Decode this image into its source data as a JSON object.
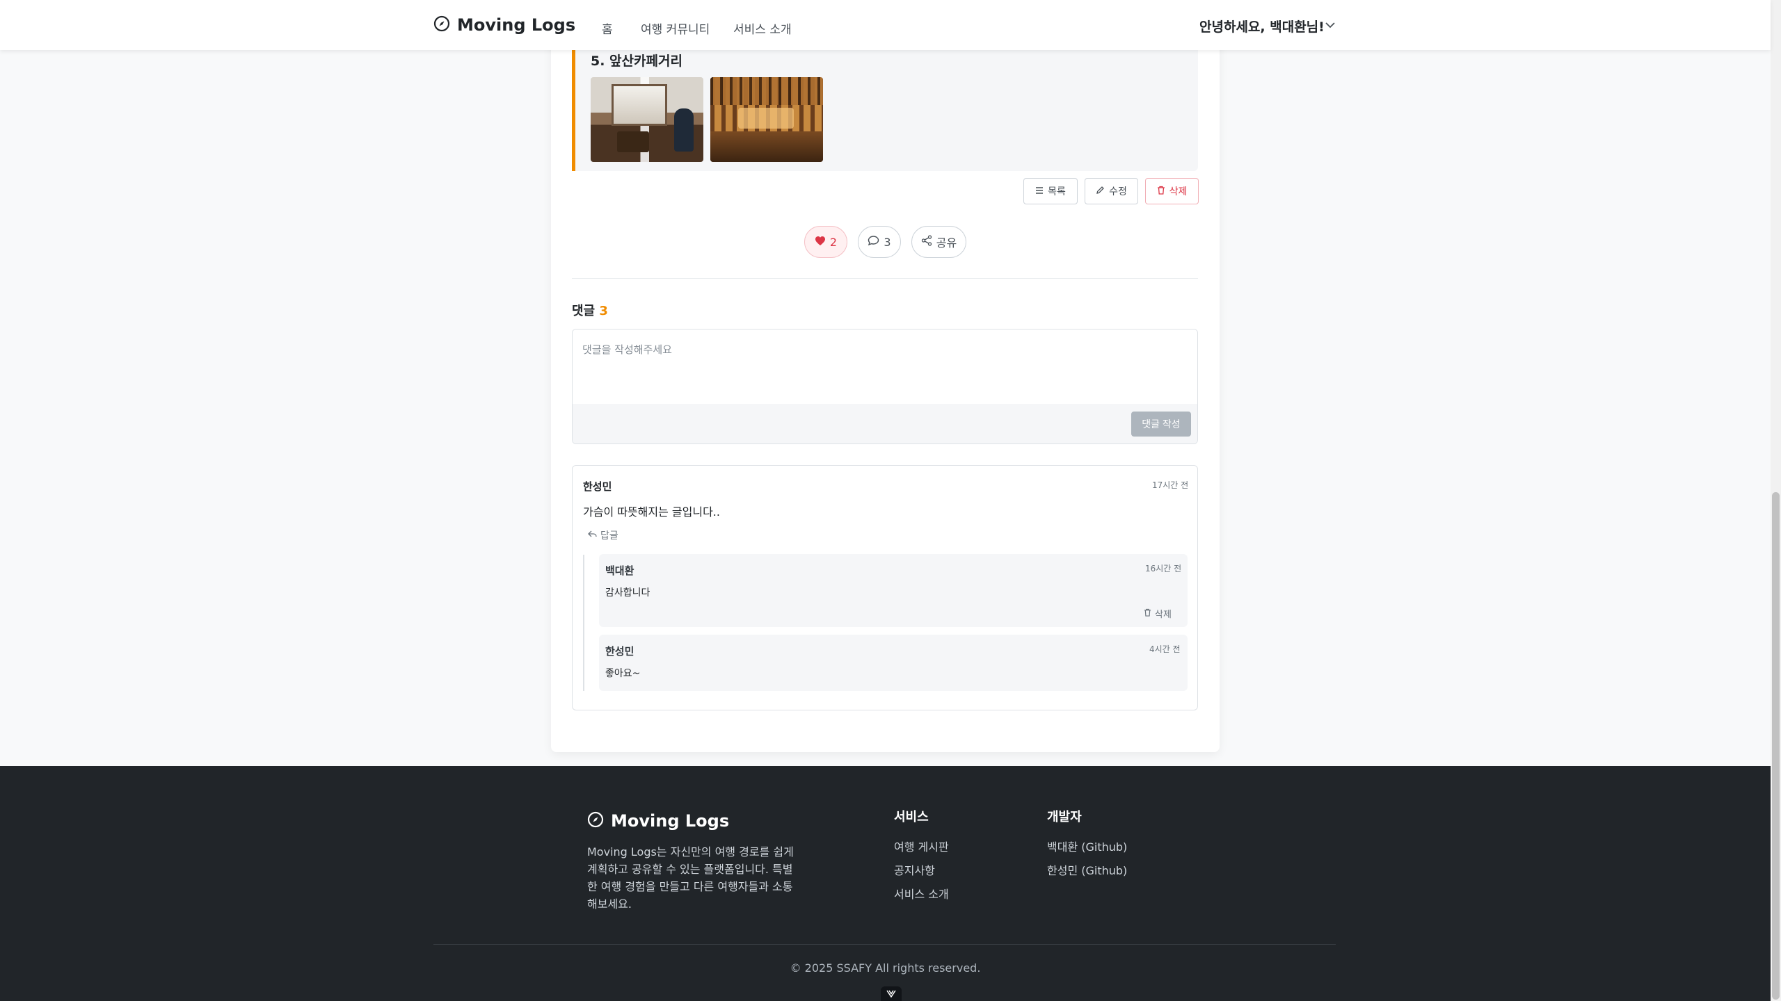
{
  "header": {
    "brand": "Moving Logs",
    "nav": [
      "홈",
      "여행 커뮤니티",
      "서비스 소개"
    ],
    "greeting": "안녕하세요, 백대환님!"
  },
  "place": {
    "title": "5. 앞산카페거리",
    "photos": [
      "cafe-photo-window",
      "cafe-photo-interior"
    ]
  },
  "actions": {
    "list_label": "목록",
    "edit_label": "수정",
    "delete_label": "삭제"
  },
  "engagement": {
    "likes": "2",
    "comments": "3",
    "share_label": "공유"
  },
  "comments": {
    "heading": "댓글",
    "count": "3",
    "placeholder": "댓글을 작성해주세요",
    "submit_label": "댓글 작성",
    "items": [
      {
        "author": "한성민",
        "time": "17시간 전",
        "body": "가슴이 따뜻해지는 글입니다..",
        "reply_label": "답글",
        "replies": [
          {
            "author": "백대환",
            "time": "16시간 전",
            "body": "감사합니다",
            "delete_label": "삭제"
          },
          {
            "author": "한성민",
            "time": "4시간 전",
            "body": "좋아요~"
          }
        ]
      }
    ]
  },
  "footer": {
    "brand": "Moving Logs",
    "description": "Moving Logs는 자신만의 여행 경로를 쉽게 계획하고 공유할 수 있는 플랫폼입니다. 특별한 여행 경험을 만들고 다른 여행자들과 소통해보세요.",
    "services_title": "서비스",
    "services": [
      "여행 게시판",
      "공지사항",
      "서비스 소개"
    ],
    "developers_title": "개발자",
    "developers": [
      "백대환 (Github)",
      "한성민 (Github)"
    ],
    "copyright": "© 2025 SSAFY All rights reserved."
  },
  "colors": {
    "accent": "#f08c00",
    "danger": "#dc3545",
    "footer_bg": "#212529"
  }
}
